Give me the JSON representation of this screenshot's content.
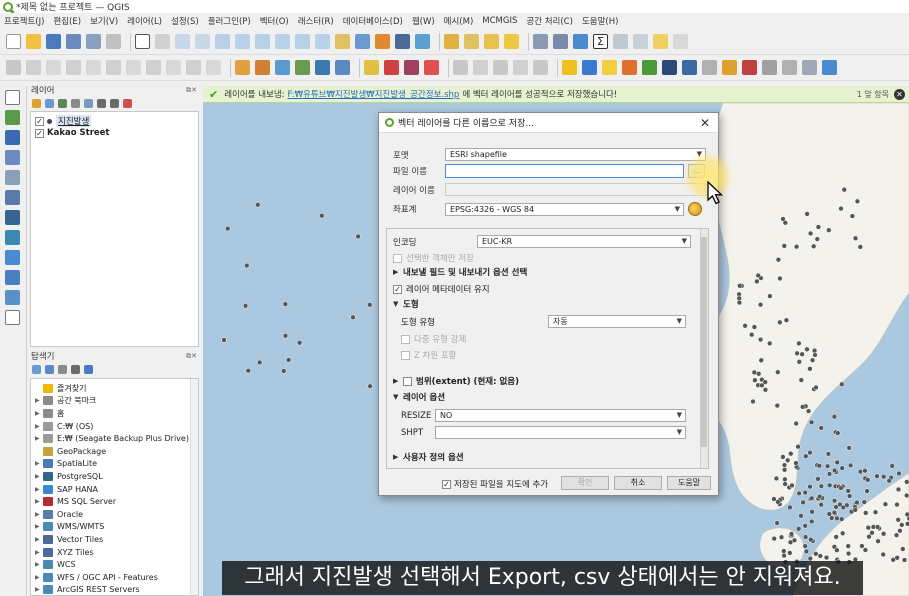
{
  "window": {
    "title": "*제목 없는 프로젝트 — QGIS"
  },
  "menubar": [
    "프로젝트(J)",
    "편집(E)",
    "보기(V)",
    "레이어(L)",
    "설정(S)",
    "플러그인(P)",
    "벡터(O)",
    "래스터(R)",
    "데이터베이스(D)",
    "웹(W)",
    "메시(M)",
    "MCMGIS",
    "공간 처리(C)",
    "도움말(H)"
  ],
  "layers_panel": {
    "title": "레이어",
    "items": [
      {
        "label": "지진발생",
        "checked": true,
        "selected": true
      },
      {
        "label": "Kakao Street",
        "checked": true,
        "selected": false
      }
    ]
  },
  "browser_panel": {
    "title": "탐색기",
    "items": [
      {
        "label": "즐겨찾기",
        "icon": "star-icon",
        "color": "#f2b705"
      },
      {
        "label": "공간 북마크",
        "icon": "bookmark-icon",
        "color": "#8a8a8a"
      },
      {
        "label": "홈",
        "icon": "home-icon",
        "color": "#8a8a8a"
      },
      {
        "label": "C:₩ (OS)",
        "icon": "drive-icon",
        "color": "#9a9a9a"
      },
      {
        "label": "E:₩ (Seagate Backup Plus Drive)",
        "icon": "drive-icon",
        "color": "#9a9a9a"
      },
      {
        "label": "GeoPackage",
        "icon": "geopackage-icon",
        "color": "#c8a040"
      },
      {
        "label": "SpatiaLite",
        "icon": "spatialite-icon",
        "color": "#4a7ab8"
      },
      {
        "label": "PostgreSQL",
        "icon": "postgresql-icon",
        "color": "#336791"
      },
      {
        "label": "SAP HANA",
        "icon": "sap-hana-icon",
        "color": "#3a8ad0"
      },
      {
        "label": "MS SQL Server",
        "icon": "mssql-icon",
        "color": "#b03030"
      },
      {
        "label": "Oracle",
        "icon": "oracle-icon",
        "color": "#5a7aa8"
      },
      {
        "label": "WMS/WMTS",
        "icon": "wms-icon",
        "color": "#4a8ab8"
      },
      {
        "label": "Vector Tiles",
        "icon": "vector-tiles-icon",
        "color": "#4a6a9a"
      },
      {
        "label": "XYZ Tiles",
        "icon": "xyz-tiles-icon",
        "color": "#4a6a9a"
      },
      {
        "label": "WCS",
        "icon": "wcs-icon",
        "color": "#4a8ab8"
      },
      {
        "label": "WFS / OGC API - Features",
        "icon": "wfs-icon",
        "color": "#4a8ab8"
      },
      {
        "label": "ArcGIS REST Servers",
        "icon": "arcgis-icon",
        "color": "#4a8ab8"
      }
    ]
  },
  "message_bar": {
    "prefix": "레이어를 내보냄:",
    "path": "F:₩유튜브₩지진발생₩지진발생_공간정보.shp",
    "suffix": "에 벡터 레이어를 성공적으로 저장했습니다!",
    "right_text": "1 앞 항목"
  },
  "dialog": {
    "title": "벡터 레이어를 다른 이름으로 저장...",
    "format_label": "포맷",
    "format_value": "ESRI shapefile",
    "filename_label": "파일 이름",
    "filename_value": "",
    "browse_label": "...",
    "layername_label": "레이어 이름",
    "crs_label": "좌표계",
    "crs_value": "EPSG:4326 - WGS 84",
    "encoding_label": "인코딩",
    "encoding_value": "EUC-KR",
    "save_selected_label": "선택한 객체만 저장",
    "export_fields_label": "내보낼 필드 및 내보내기 옵션 선택",
    "keep_metadata_label": "레이어 메타데이터 유지",
    "geometry_section": "도형",
    "geometry_type_label": "도형 유형",
    "geometry_type_value": "자동",
    "force_multi_label": "다중 유형 강제",
    "include_z_label": "Z 차원 포함",
    "extent_label": "범위(extent) (현재: 없음)",
    "layer_options_section": "레이어 옵션",
    "resize_label": "RESIZE",
    "resize_value": "NO",
    "shpt_label": "SHPT",
    "shpt_value": "",
    "custom_options_label": "사용자 정의 옵션",
    "add_to_map_label": "저장된 파일을 지도에 추가",
    "ok_label": "확인",
    "cancel_label": "취소",
    "help_label": "도움말"
  },
  "subtitle": "그래서 지진발생 선택해서 Export, csv 상태에서는 안 지워져요.",
  "colors": {
    "map_sea": "#aac8df",
    "map_land": "#f4f2ec",
    "accent_green": "#5ba22c"
  }
}
